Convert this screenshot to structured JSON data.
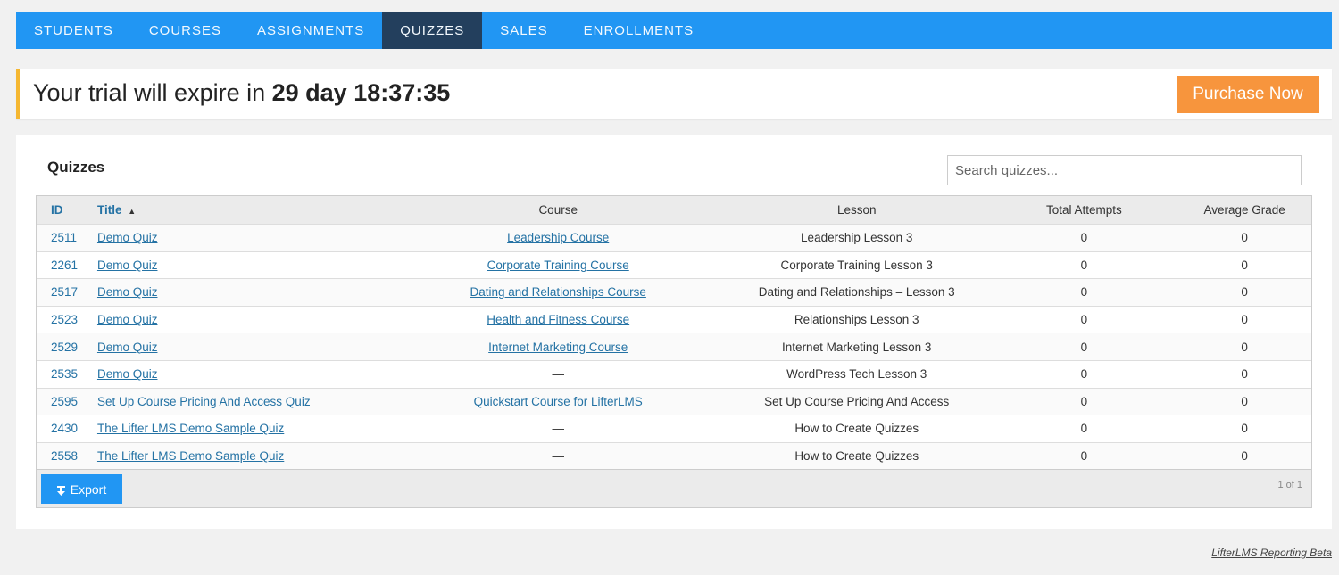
{
  "nav": {
    "tabs": [
      {
        "label": "STUDENTS"
      },
      {
        "label": "COURSES"
      },
      {
        "label": "ASSIGNMENTS"
      },
      {
        "label": "QUIZZES"
      },
      {
        "label": "SALES"
      },
      {
        "label": "ENROLLMENTS"
      }
    ],
    "active_index": 3
  },
  "trial": {
    "prefix": "Your trial will expire in",
    "countdown": "29 day 18:37:35",
    "purchase_label": "Purchase Now"
  },
  "panel": {
    "title": "Quizzes",
    "search_placeholder": "Search quizzes..."
  },
  "table": {
    "columns": {
      "id": "ID",
      "title": "Title",
      "title_sort_icon": "▲",
      "course": "Course",
      "lesson": "Lesson",
      "attempts": "Total Attempts",
      "grade": "Average Grade"
    },
    "rows": [
      {
        "id": "2511",
        "title": "Demo Quiz",
        "course": "Leadership Course",
        "course_link": true,
        "lesson": "Leadership Lesson 3",
        "attempts": "0",
        "grade": "0"
      },
      {
        "id": "2261",
        "title": "Demo Quiz",
        "course": "Corporate Training Course",
        "course_link": true,
        "lesson": "Corporate Training Lesson 3",
        "attempts": "0",
        "grade": "0"
      },
      {
        "id": "2517",
        "title": "Demo Quiz",
        "course": "Dating and Relationships Course",
        "course_link": true,
        "lesson": "Dating and Relationships – Lesson 3",
        "attempts": "0",
        "grade": "0"
      },
      {
        "id": "2523",
        "title": "Demo Quiz",
        "course": "Health and Fitness Course",
        "course_link": true,
        "lesson": "Relationships Lesson 3",
        "attempts": "0",
        "grade": "0"
      },
      {
        "id": "2529",
        "title": "Demo Quiz",
        "course": "Internet Marketing Course",
        "course_link": true,
        "lesson": "Internet Marketing Lesson 3",
        "attempts": "0",
        "grade": "0"
      },
      {
        "id": "2535",
        "title": "Demo Quiz",
        "course": "—",
        "course_link": false,
        "lesson": "WordPress Tech Lesson 3",
        "attempts": "0",
        "grade": "0"
      },
      {
        "id": "2595",
        "title": "Set Up Course Pricing And Access Quiz",
        "course": "Quickstart Course for LifterLMS",
        "course_link": true,
        "lesson": "Set Up Course Pricing And Access",
        "attempts": "0",
        "grade": "0"
      },
      {
        "id": "2430",
        "title": "The Lifter LMS Demo Sample Quiz",
        "course": "—",
        "course_link": false,
        "lesson": "How to Create Quizzes",
        "attempts": "0",
        "grade": "0"
      },
      {
        "id": "2558",
        "title": "The Lifter LMS Demo Sample Quiz",
        "course": "—",
        "course_link": false,
        "lesson": "How to Create Quizzes",
        "attempts": "0",
        "grade": "0"
      }
    ],
    "export_label": "Export",
    "export_icon": "download-icon",
    "pager": "1 of 1"
  },
  "footer": {
    "link": "LifterLMS Reporting Beta"
  },
  "colors": {
    "nav_bg": "#2196f3",
    "nav_active": "#243b55",
    "trial_accent": "#f5b731",
    "purchase_bg": "#f7953d",
    "link": "#2472a4"
  }
}
